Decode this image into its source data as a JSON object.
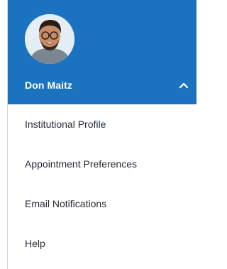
{
  "user": {
    "name": "Don Maitz",
    "avatar_icon": "user-avatar",
    "toggle_icon": "chevron-up-icon"
  },
  "menu": {
    "items": [
      {
        "label": "Institutional Profile"
      },
      {
        "label": "Appointment Preferences"
      },
      {
        "label": "Email Notifications"
      },
      {
        "label": "Help"
      }
    ]
  },
  "colors": {
    "header_bg": "#1b73bf",
    "header_text": "#ffffff",
    "menu_text": "#1f2a36"
  }
}
